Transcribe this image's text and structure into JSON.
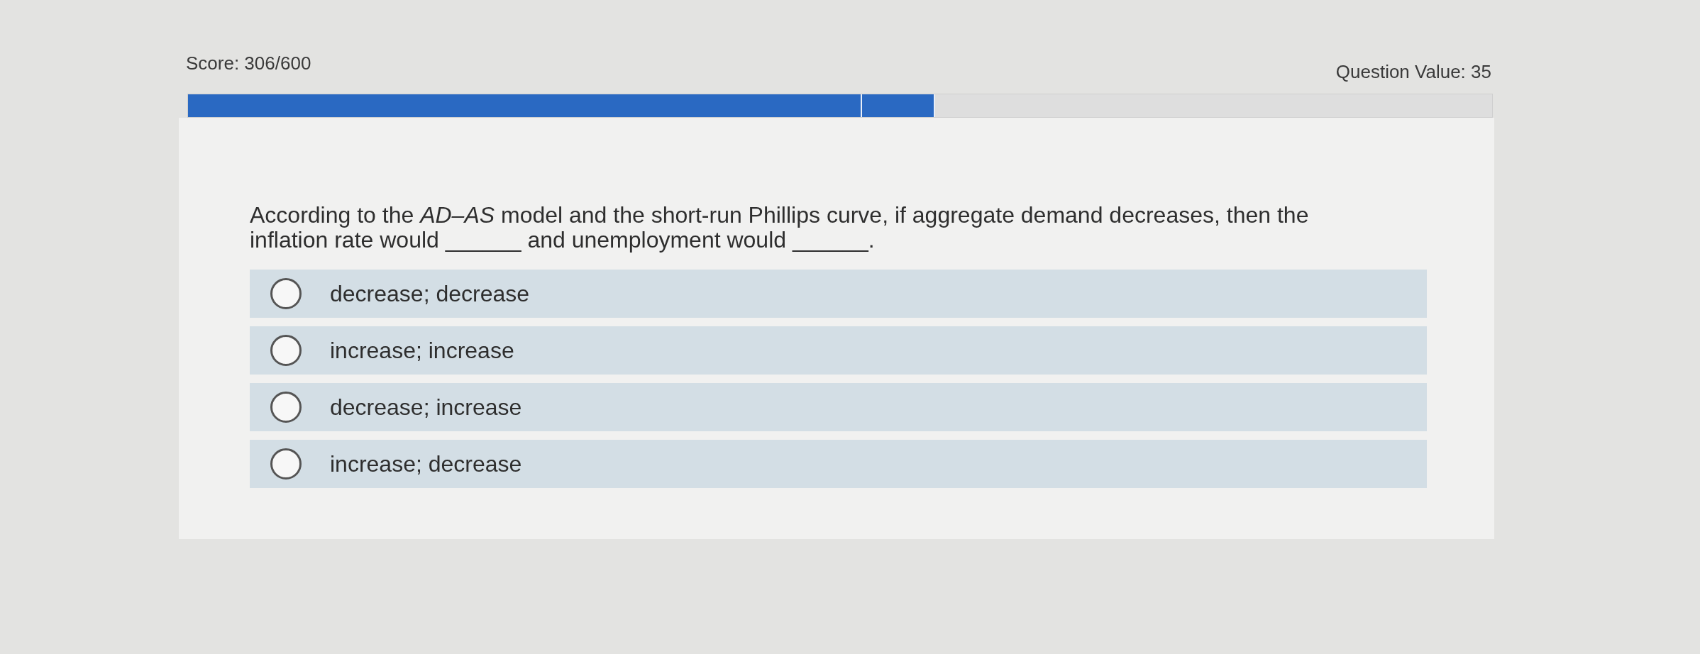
{
  "header": {
    "score": "Score: 306/600",
    "question_value": "Question Value: 35"
  },
  "progress": {
    "fills": [
      {
        "level": 0.573
      },
      {
        "level": 0.517
      }
    ]
  },
  "question": {
    "text": "According to the *AD–AS* model and the short-run Phillips curve, if aggregate demand decreases, then the inflation rate would ______ and unemployment would ______."
  },
  "options": [
    {
      "label": "decrease; decrease",
      "selected": false
    },
    {
      "label": "increase; increase",
      "selected": false
    },
    {
      "label": "decrease; increase",
      "selected": false
    },
    {
      "label": "increase; decrease",
      "selected": false
    }
  ]
}
